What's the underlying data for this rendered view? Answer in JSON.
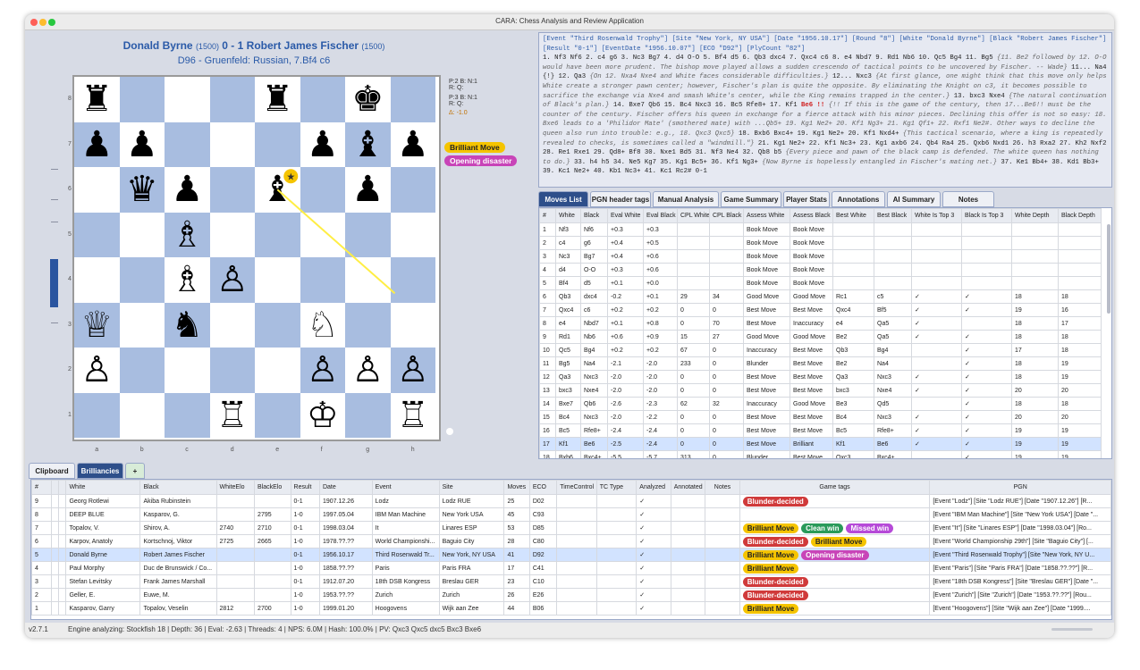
{
  "window": {
    "title": "CARA: Chess Analysis and Review Application"
  },
  "game_header": {
    "white": "Donald Byrne",
    "white_elo": "(1500)",
    "result": "0 - 1",
    "black": "Robert James Fischer",
    "black_elo": "(1500)",
    "opening": "D96 - Gruenfeld: Russian, 7.Bf4 c6"
  },
  "material": {
    "l1": "P:2 B:  N:1",
    "l2": "R:  Q:",
    "l3": "P:3 B:  N:1",
    "l4": "R:  Q:",
    "l5": "Δ: -1.0"
  },
  "board_tags": [
    {
      "label": "Brilliant Move",
      "color": "#f5c400"
    },
    {
      "label": "Opening disaster",
      "color": "#c844b8"
    }
  ],
  "board": {
    "files": [
      "a",
      "b",
      "c",
      "d",
      "e",
      "f",
      "g",
      "h"
    ],
    "ranks": [
      "8",
      "7",
      "6",
      "5",
      "4",
      "3",
      "2",
      "1"
    ],
    "pieces": [
      {
        "sq": "a8",
        "glyph": "♜",
        "side": "b"
      },
      {
        "sq": "e8",
        "glyph": "♜",
        "side": "b"
      },
      {
        "sq": "g8",
        "glyph": "♚",
        "side": "b"
      },
      {
        "sq": "a7",
        "glyph": "♟",
        "side": "b"
      },
      {
        "sq": "b7",
        "glyph": "♟",
        "side": "b"
      },
      {
        "sq": "f7",
        "glyph": "♟",
        "side": "b"
      },
      {
        "sq": "g7",
        "glyph": "♝",
        "side": "b"
      },
      {
        "sq": "h7",
        "glyph": "♟",
        "side": "b"
      },
      {
        "sq": "b6",
        "glyph": "♛",
        "side": "b"
      },
      {
        "sq": "c6",
        "glyph": "♟",
        "side": "b"
      },
      {
        "sq": "e6",
        "glyph": "♝",
        "side": "b"
      },
      {
        "sq": "g6",
        "glyph": "♟",
        "side": "b"
      },
      {
        "sq": "c5",
        "glyph": "♗",
        "side": "w"
      },
      {
        "sq": "c4",
        "glyph": "♗",
        "side": "w"
      },
      {
        "sq": "d4",
        "glyph": "♙",
        "side": "w"
      },
      {
        "sq": "a3",
        "glyph": "♕",
        "side": "w"
      },
      {
        "sq": "c3",
        "glyph": "♞",
        "side": "b"
      },
      {
        "sq": "f3",
        "glyph": "♘",
        "side": "w"
      },
      {
        "sq": "a2",
        "glyph": "♙",
        "side": "w"
      },
      {
        "sq": "f2",
        "glyph": "♙",
        "side": "w"
      },
      {
        "sq": "g2",
        "glyph": "♙",
        "side": "w"
      },
      {
        "sq": "h2",
        "glyph": "♙",
        "side": "w"
      },
      {
        "sq": "d1",
        "glyph": "♖",
        "side": "w"
      },
      {
        "sq": "f1",
        "glyph": "♔",
        "side": "w"
      },
      {
        "sq": "h1",
        "glyph": "♖",
        "side": "w"
      }
    ],
    "star_square": "e6",
    "arrow": {
      "from": "e6",
      "to": "g4",
      "color": "#ffee44"
    }
  },
  "pgn_text": {
    "header": "[Event \"Third Rosenwald Trophy\"] [Site \"New York, NY USA\"] [Date \"1956.10.17\"] [Round \"8\"] [White \"Donald Byrne\"] [Black \"Robert James Fischer\"] [Result \"0-1\"] [EventDate \"1956.10.07\"] [ECO \"D92\"] [PlyCount \"82\"]",
    "p1": "1. Nf3 Nf6 2. c4 g6 3. Nc3 Bg7 4. d4 O-O 5. Bf4 d5 6. Qb3 dxc4 7. Qxc4 c6 8. e4 Nbd7 9. Rd1 Nb6 10. Qc5 Bg4 11. Bg5 ",
    "c1": "{11. Be2 followed by 12. O-O would have been more prudent. The bishop move played allows a sudden crescendo of tactical points to be uncovered by Fischer. -- Wade}",
    "p2": " 11... Na4 {!} 12. Qa3 ",
    "c2": "{On 12. Nxa4 Nxe4 and White faces considerable difficulties.}",
    "p3": " 12... Nxc3 ",
    "c3": "{At first glance, one might think that this move only helps White create a stronger pawn center; however, Fischer's plan is quite the opposite. By eliminating the Knight on c3, it becomes possible to sacrifice the exchange via Nxe4 and smash White's center, while the King remains trapped in the center.}",
    "p4": " 13. bxc3 Nxe4 ",
    "c4": "{The natural continuation of Black's plan.}",
    "p5": " 14. Bxe7 Qb6 15. Bc4 Nxc3 16. Bc5 Rfe8+ 17. Kf1 ",
    "blunder": "Be6 !!",
    "c5": " {!! If this is the game of the century, then 17...Be6!! must be the counter of the century. Fischer offers his queen in exchange for a fierce attack with his minor pieces. Declining this offer is not so easy: 18. Bxe6 leads to a 'Philidor Mate' (smothered mate) with ...Qb5+ 19. Kg1 Ne2+ 20. Kf1 Ng3+ 21. Kg1 Qf1+ 22. Rxf1 Ne2#. Other ways to decline the queen also run into trouble: e.g., 18. Qxc3 Qxc5}",
    "p6": " 18. Bxb6 Bxc4+ 19. Kg1 Ne2+ 20. Kf1 Nxd4+ ",
    "c6": "{This tactical scenario, where a king is repeatedly revealed to checks, is sometimes called a \"windmill.\"}",
    "p7": " 21. Kg1 Ne2+ 22. Kf1 Nc3+ 23. Kg1 axb6 24. Qb4 Ra4 25. Qxb6 Nxd1 26. h3 Rxa2 27. Kh2 Nxf2 28. Re1 Rxe1 29. Qd8+ Bf8 30. Nxe1 Bd5 31. Nf3 Ne4 32. Qb8 b5 ",
    "c7": "{Every piece and pawn of the black camp is defended. The white queen has nothing to do.}",
    "p8": " 33. h4 h5 34. Ne5 Kg7 35. Kg1 Bc5+ 36. Kf1 Ng3+ ",
    "c8": "{Now Byrne is hopelessly entangled in Fischer's mating net.}",
    "p9": " 37. Ke1 Bb4+ 38. Kd1 Bb3+ 39. Kc1 Ne2+ 40. Kb1 Nc3+ 41. Kc1 Rc2# 0-1"
  },
  "analysis_tabs": [
    "Moves List",
    "PGN header tags",
    "Manual Analysis",
    "Game Summary",
    "Player Stats",
    "Annotations",
    "AI Summary",
    "Notes"
  ],
  "moves_columns": [
    "#",
    "White",
    "Black",
    "Eval White",
    "Eval Black",
    "CPL White",
    "CPL Black",
    "Assess White",
    "Assess Black",
    "Best White",
    "Best Black",
    "White Is Top 3",
    "Black Is Top 3",
    "White Depth",
    "Black Depth"
  ],
  "moves_rows": [
    [
      "1",
      "Nf3",
      "Nf6",
      "+0.3",
      "+0.3",
      "",
      "",
      "Book Move",
      "Book Move",
      "",
      "",
      "",
      "",
      "",
      ""
    ],
    [
      "2",
      "c4",
      "g6",
      "+0.4",
      "+0.5",
      "",
      "",
      "Book Move",
      "Book Move",
      "",
      "",
      "",
      "",
      "",
      ""
    ],
    [
      "3",
      "Nc3",
      "Bg7",
      "+0.4",
      "+0.6",
      "",
      "",
      "Book Move",
      "Book Move",
      "",
      "",
      "",
      "",
      "",
      ""
    ],
    [
      "4",
      "d4",
      "O-O",
      "+0.3",
      "+0.6",
      "",
      "",
      "Book Move",
      "Book Move",
      "",
      "",
      "",
      "",
      "",
      ""
    ],
    [
      "5",
      "Bf4",
      "d5",
      "+0.1",
      "+0.0",
      "",
      "",
      "Book Move",
      "Book Move",
      "",
      "",
      "",
      "",
      "",
      ""
    ],
    [
      "6",
      "Qb3",
      "dxc4",
      "-0.2",
      "+0.1",
      "29",
      "34",
      "Good Move",
      "Good Move",
      "Rc1",
      "c5",
      "✓",
      "✓",
      "18",
      "18"
    ],
    [
      "7",
      "Qxc4",
      "c6",
      "+0.2",
      "+0.2",
      "0",
      "0",
      "Best Move",
      "Best Move",
      "Qxc4",
      "Bf5",
      "✓",
      "✓",
      "19",
      "16"
    ],
    [
      "8",
      "e4",
      "Nbd7",
      "+0.1",
      "+0.8",
      "0",
      "70",
      "Best Move",
      "Inaccuracy",
      "e4",
      "Qa5",
      "✓",
      "",
      "18",
      "17"
    ],
    [
      "9",
      "Rd1",
      "Nb6",
      "+0.6",
      "+0.9",
      "15",
      "27",
      "Good Move",
      "Good Move",
      "Be2",
      "Qa5",
      "✓",
      "✓",
      "18",
      "18"
    ],
    [
      "10",
      "Qc5",
      "Bg4",
      "+0.2",
      "+0.2",
      "67",
      "0",
      "Inaccuracy",
      "Best Move",
      "Qb3",
      "Bg4",
      "",
      "✓",
      "17",
      "18"
    ],
    [
      "11",
      "Bg5",
      "Na4",
      "-2.1",
      "-2.0",
      "233",
      "0",
      "Blunder",
      "Best Move",
      "Be2",
      "Na4",
      "",
      "✓",
      "18",
      "19"
    ],
    [
      "12",
      "Qa3",
      "Nxc3",
      "-2.0",
      "-2.0",
      "0",
      "0",
      "Best Move",
      "Best Move",
      "Qa3",
      "Nxc3",
      "✓",
      "✓",
      "18",
      "19"
    ],
    [
      "13",
      "bxc3",
      "Nxe4",
      "-2.0",
      "-2.0",
      "0",
      "0",
      "Best Move",
      "Best Move",
      "bxc3",
      "Nxe4",
      "✓",
      "✓",
      "20",
      "20"
    ],
    [
      "14",
      "Bxe7",
      "Qb6",
      "-2.6",
      "-2.3",
      "62",
      "32",
      "Inaccuracy",
      "Good Move",
      "Be3",
      "Qd5",
      "",
      "✓",
      "18",
      "18"
    ],
    [
      "15",
      "Bc4",
      "Nxc3",
      "-2.0",
      "-2.2",
      "0",
      "0",
      "Best Move",
      "Best Move",
      "Bc4",
      "Nxc3",
      "✓",
      "✓",
      "20",
      "20"
    ],
    [
      "16",
      "Bc5",
      "Rfe8+",
      "-2.4",
      "-2.4",
      "0",
      "0",
      "Best Move",
      "Best Move",
      "Bc5",
      "Rfe8+",
      "✓",
      "✓",
      "19",
      "19"
    ],
    [
      "17",
      "Kf1",
      "Be6",
      "-2.5",
      "-2.4",
      "0",
      "0",
      "Best Move",
      "Brilliant",
      "Kf1",
      "Be6",
      "✓",
      "✓",
      "19",
      "19"
    ],
    [
      "18",
      "Bxb6",
      "Bxc4+",
      "-5.5",
      "-5.7",
      "313",
      "0",
      "Blunder",
      "Best Move",
      "Qxc3",
      "Bxc4+",
      "",
      "✓",
      "19",
      "19"
    ]
  ],
  "bottom_tabs": [
    "Clipboard",
    "Brilliancies",
    "+"
  ],
  "games_columns": [
    "#",
    "",
    "",
    "White",
    "Black",
    "WhiteElo",
    "BlackElo",
    "Result",
    "Date",
    "Event",
    "Site",
    "Moves",
    "ECO",
    "TimeControl",
    "TC Type",
    "Analyzed",
    "Annotated",
    "Notes",
    "Game tags",
    "PGN"
  ],
  "games_rows": [
    {
      "n": "9",
      "white": "Georg Rotlewi",
      "black": "Akiba Rubinstein",
      "welo": "",
      "belo": "",
      "result": "0-1",
      "date": "1907.12.26",
      "event": "Lodz",
      "site": "Lodz RUE",
      "moves": "25",
      "eco": "D02",
      "analyzed": "✓",
      "tags": [
        {
          "label": "Blunder-decided",
          "color": "#d03a3a",
          "text": "#fff"
        }
      ],
      "pgn": "[Event \"Lodz\"] [Site \"Lodz RUE\"] [Date \"1907.12.26\"] [R..."
    },
    {
      "n": "8",
      "white": "DEEP BLUE",
      "black": "Kasparov, G.",
      "welo": "",
      "belo": "2795",
      "result": "1-0",
      "date": "1997.05.04",
      "event": "IBM Man Machine",
      "site": "New York USA",
      "moves": "45",
      "eco": "C93",
      "analyzed": "✓",
      "tags": [],
      "pgn": "[Event \"IBM Man Machine\"] [Site \"New York USA\"] [Date \"..."
    },
    {
      "n": "7",
      "white": "Topalov, V.",
      "black": "Shirov, A.",
      "welo": "2740",
      "belo": "2710",
      "result": "0-1",
      "date": "1998.03.04",
      "event": "It",
      "site": "Linares ESP",
      "moves": "53",
      "eco": "D85",
      "analyzed": "✓",
      "tags": [
        {
          "label": "Brilliant Move",
          "color": "#f5c400",
          "text": "#222"
        },
        {
          "label": "Clean win",
          "color": "#2a9a5a",
          "text": "#fff"
        },
        {
          "label": "Missed win",
          "color": "#b64ad8",
          "text": "#fff"
        }
      ],
      "pgn": "[Event \"It\"] [Site \"Linares ESP\"] [Date \"1998.03.04\"] [Ro..."
    },
    {
      "n": "6",
      "white": "Karpov, Anatoly",
      "black": "Kortschnoj, Viktor",
      "welo": "2725",
      "belo": "2665",
      "result": "1-0",
      "date": "1978.??.??",
      "event": "World Championshi...",
      "site": "Baguio City",
      "moves": "28",
      "eco": "C80",
      "analyzed": "✓",
      "tags": [
        {
          "label": "Blunder-decided",
          "color": "#d03a3a",
          "text": "#fff"
        },
        {
          "label": "Brilliant Move",
          "color": "#f5c400",
          "text": "#222"
        }
      ],
      "pgn": "[Event \"World Championship 29th\"] [Site \"Baguio City\"] [..."
    },
    {
      "n": "5",
      "white": "Donald Byrne",
      "black": "Robert James Fischer",
      "welo": "",
      "belo": "",
      "result": "0-1",
      "date": "1956.10.17",
      "event": "Third Rosenwald Tr...",
      "site": "New York, NY USA",
      "moves": "41",
      "eco": "D92",
      "analyzed": "✓",
      "tags": [
        {
          "label": "Brilliant Move",
          "color": "#f5c400",
          "text": "#222"
        },
        {
          "label": "Opening disaster",
          "color": "#c844b8",
          "text": "#fff"
        }
      ],
      "pgn": "[Event \"Third Rosenwald Trophy\"] [Site \"New York, NY U...",
      "selected": true
    },
    {
      "n": "4",
      "white": "Paul Morphy",
      "black": "Duc de Brunswick / Co...",
      "welo": "",
      "belo": "",
      "result": "1-0",
      "date": "1858.??.??",
      "event": "Paris",
      "site": "Paris FRA",
      "moves": "17",
      "eco": "C41",
      "analyzed": "✓",
      "tags": [
        {
          "label": "Brilliant Move",
          "color": "#f5c400",
          "text": "#222"
        }
      ],
      "pgn": "[Event \"Paris\"] [Site \"Paris FRA\"] [Date \"1858.??.??\"] [R..."
    },
    {
      "n": "3",
      "white": "Stefan Levitsky",
      "black": "Frank James Marshall",
      "welo": "",
      "belo": "",
      "result": "0-1",
      "date": "1912.07.20",
      "event": "18th DSB Kongress",
      "site": "Breslau GER",
      "moves": "23",
      "eco": "C10",
      "analyzed": "✓",
      "tags": [
        {
          "label": "Blunder-decided",
          "color": "#d03a3a",
          "text": "#fff"
        }
      ],
      "pgn": "[Event \"18th DSB Kongress\"] [Site \"Breslau GER\"] [Date \"..."
    },
    {
      "n": "2",
      "white": "Geller, E.",
      "black": "Euwe, M.",
      "welo": "",
      "belo": "",
      "result": "1-0",
      "date": "1953.??.??",
      "event": "Zurich",
      "site": "Zurich",
      "moves": "26",
      "eco": "E26",
      "analyzed": "✓",
      "tags": [
        {
          "label": "Blunder-decided",
          "color": "#d03a3a",
          "text": "#fff"
        }
      ],
      "pgn": "[Event \"Zurich\"] [Site \"Zurich\"] [Date \"1953.??.??\"] [Rou..."
    },
    {
      "n": "1",
      "white": "Kasparov, Garry",
      "black": "Topalov, Veselin",
      "welo": "2812",
      "belo": "2700",
      "result": "1-0",
      "date": "1999.01.20",
      "event": "Hoogovens",
      "site": "Wijk aan Zee",
      "moves": "44",
      "eco": "B06",
      "analyzed": "✓",
      "tags": [
        {
          "label": "Brilliant Move",
          "color": "#f5c400",
          "text": "#222"
        }
      ],
      "pgn": "[Event \"Hoogovens\"] [Site \"Wijk aan Zee\"] [Date \"1999...."
    }
  ],
  "status": {
    "version": "v2.7.1",
    "engine": "Engine analyzing: Stockfish 18 | Depth: 36 | Eval: -2.63 | Threads: 4 | NPS: 6.0M | Hash: 100.0% | PV: Qxc3 Qxc5 dxc5 Bxc3 Bxe6"
  },
  "colors": {
    "light_square": "#ffffff",
    "dark_square": "#a8bde0",
    "accent": "#2e4f8a"
  }
}
